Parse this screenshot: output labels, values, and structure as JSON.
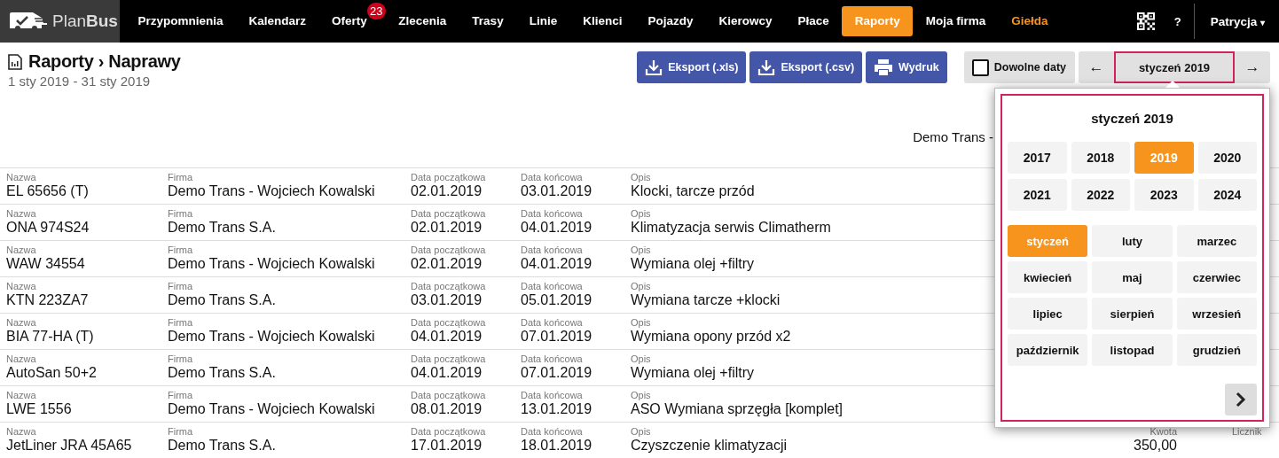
{
  "logo": {
    "text": "Plan**Bus**"
  },
  "nav": [
    {
      "label": "Przypomnienia",
      "selected": false,
      "kind": "normal"
    },
    {
      "label": "Kalendarz",
      "selected": false,
      "kind": "normal"
    },
    {
      "label": "Oferty",
      "selected": false,
      "kind": "normal",
      "badge": "23"
    },
    {
      "label": "Zlecenia",
      "selected": false,
      "kind": "normal"
    },
    {
      "label": "Trasy",
      "selected": false,
      "kind": "normal"
    },
    {
      "label": "Linie",
      "selected": false,
      "kind": "normal"
    },
    {
      "label": "Klienci",
      "selected": false,
      "kind": "normal"
    },
    {
      "label": "Pojazdy",
      "selected": false,
      "kind": "normal"
    },
    {
      "label": "Kierowcy",
      "selected": false,
      "kind": "normal"
    },
    {
      "label": "Płace",
      "selected": false,
      "kind": "normal"
    },
    {
      "label": "Raporty",
      "selected": true,
      "kind": "normal"
    },
    {
      "label": "Moja firma",
      "selected": false,
      "kind": "normal"
    },
    {
      "label": "Giełda",
      "selected": false,
      "kind": "accent"
    }
  ],
  "help": "?",
  "user": {
    "name": "Patrycja",
    "caret": "▾"
  },
  "page": {
    "title": "Raporty › Naprawy",
    "range": "1 sty 2019 - 31 sty 2019"
  },
  "actions": [
    {
      "label": "Eksport (.xls)",
      "kind": "download"
    },
    {
      "label": "Eksport (.csv)",
      "kind": "download"
    },
    {
      "label": "Wydruk",
      "kind": "print"
    }
  ],
  "free_dates": {
    "label": "Dowolne daty",
    "checked": false
  },
  "period": {
    "prev": "←",
    "label": "styczeń 2019",
    "next": "→"
  },
  "company_heading": "Demo Trans -",
  "rows": [
    {
      "cells": [
        {
          "label": "Nazwa",
          "value": "EL 65656 (T)"
        },
        {
          "label": "Firma",
          "value": "Demo Trans - Wojciech Kowalski"
        },
        {
          "label": "Data początkowa",
          "value": "02.01.2019"
        },
        {
          "label": "Data końcowa",
          "value": "03.01.2019"
        },
        {
          "label": "Opis",
          "value": "Klocki, tarcze przód"
        }
      ]
    },
    {
      "cells": [
        {
          "label": "Nazwa",
          "value": "ONA 974S24"
        },
        {
          "label": "Firma",
          "value": "Demo Trans S.A."
        },
        {
          "label": "Data początkowa",
          "value": "02.01.2019"
        },
        {
          "label": "Data końcowa",
          "value": "04.01.2019"
        },
        {
          "label": "Opis",
          "value": "Klimatyzacja serwis Climatherm"
        }
      ]
    },
    {
      "cells": [
        {
          "label": "Nazwa",
          "value": "WAW 34554"
        },
        {
          "label": "Firma",
          "value": "Demo Trans - Wojciech Kowalski"
        },
        {
          "label": "Data początkowa",
          "value": "02.01.2019"
        },
        {
          "label": "Data końcowa",
          "value": "04.01.2019"
        },
        {
          "label": "Opis",
          "value": "Wymiana olej +filtry"
        }
      ]
    },
    {
      "cells": [
        {
          "label": "Nazwa",
          "value": "KTN 223ZA7"
        },
        {
          "label": "Firma",
          "value": "Demo Trans S.A."
        },
        {
          "label": "Data początkowa",
          "value": "03.01.2019"
        },
        {
          "label": "Data końcowa",
          "value": "05.01.2019"
        },
        {
          "label": "Opis",
          "value": "Wymiana tarcze +klocki"
        }
      ]
    },
    {
      "cells": [
        {
          "label": "Nazwa",
          "value": "BIA 77-HA (T)"
        },
        {
          "label": "Firma",
          "value": "Demo Trans - Wojciech Kowalski"
        },
        {
          "label": "Data początkowa",
          "value": "04.01.2019"
        },
        {
          "label": "Data końcowa",
          "value": "07.01.2019"
        },
        {
          "label": "Opis",
          "value": "Wymiana opony przód x2"
        }
      ]
    },
    {
      "cells": [
        {
          "label": "Nazwa",
          "value": "AutoSan 50+2"
        },
        {
          "label": "Firma",
          "value": "Demo Trans S.A."
        },
        {
          "label": "Data początkowa",
          "value": "04.01.2019"
        },
        {
          "label": "Data końcowa",
          "value": "07.01.2019"
        },
        {
          "label": "Opis",
          "value": "Wymiana olej +filtry"
        }
      ]
    },
    {
      "cells": [
        {
          "label": "Nazwa",
          "value": "LWE 1556"
        },
        {
          "label": "Firma",
          "value": "Demo Trans - Wojciech Kowalski"
        },
        {
          "label": "Data początkowa",
          "value": "08.01.2019"
        },
        {
          "label": "Data końcowa",
          "value": "13.01.2019"
        },
        {
          "label": "Opis",
          "value": "ASO Wymiana sprzęgła [komplet]"
        }
      ]
    },
    {
      "cells": [
        {
          "label": "Nazwa",
          "value": "JetLiner JRA 45A65"
        },
        {
          "label": "Firma",
          "value": "Demo Trans S.A."
        },
        {
          "label": "Data początkowa",
          "value": "17.01.2019"
        },
        {
          "label": "Data końcowa",
          "value": "18.01.2019"
        },
        {
          "label": "Opis",
          "value": "Czyszczenie klimatyzacji"
        },
        {
          "label": "Kwota",
          "value": "350,00"
        },
        {
          "label": "Licznik"
        }
      ]
    }
  ],
  "picker": {
    "title": "styczeń 2019",
    "years": [
      {
        "label": "2017",
        "selected": false
      },
      {
        "label": "2018",
        "selected": false
      },
      {
        "label": "2019",
        "selected": true
      },
      {
        "label": "2020",
        "selected": false
      },
      {
        "label": "2021",
        "selected": false
      },
      {
        "label": "2022",
        "selected": false
      },
      {
        "label": "2023",
        "selected": false
      },
      {
        "label": "2024",
        "selected": false
      }
    ],
    "months": [
      {
        "label": "styczeń",
        "selected": true
      },
      {
        "label": "luty",
        "selected": false
      },
      {
        "label": "marzec",
        "selected": false
      },
      {
        "label": "kwiecień",
        "selected": false
      },
      {
        "label": "maj",
        "selected": false
      },
      {
        "label": "czerwiec",
        "selected": false
      },
      {
        "label": "lipiec",
        "selected": false
      },
      {
        "label": "sierpień",
        "selected": false
      },
      {
        "label": "wrzesień",
        "selected": false
      },
      {
        "label": "październik",
        "selected": false
      },
      {
        "label": "listopad",
        "selected": false
      },
      {
        "label": "grudzień",
        "selected": false
      }
    ]
  }
}
